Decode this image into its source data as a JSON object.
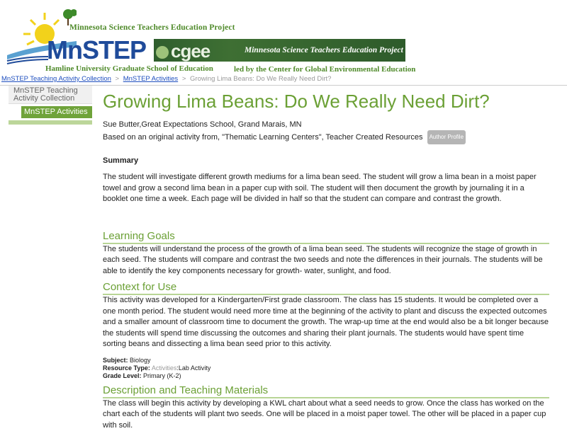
{
  "header": {
    "project_top": "Minnesota Science Teachers Education Project",
    "brand": "MnSTEP",
    "hamline": "Hamline University Graduate School of Education",
    "cgee_logo": "cgee",
    "cgee_project": "Minnesota Science Teachers Education Project",
    "cgee_led": "led by the Center for Global Environmental Education"
  },
  "breadcrumb": {
    "items": [
      "MnSTEP Teaching Activity Collection",
      "MnSTEP Activities",
      "Growing Lima Beans: Do We Really Need Dirt?"
    ],
    "separator": ">"
  },
  "sidebar": {
    "title": "MnSTEP Teaching Activity Collection",
    "active": "MnSTEP Activities"
  },
  "page": {
    "title": "Growing Lima Beans: Do We Really Need Dirt?",
    "author_line": "Sue Butter,Great Expectations School, Grand Marais, MN",
    "source_line": "Based on an original activity from, \"Thematic Learning Centers\", Teacher Created Resources",
    "author_profile": "Author Profile",
    "summary_heading": "Summary",
    "summary_text": "The student will investigate different growth mediums for a lima bean seed. The student will grow a lima bean in a moist paper towel and grow a second lima bean in a paper cup with soil. The student will then document the growth by journaling it in a booklet one time a week. Each page will be divided in half so that the student can compare and contrast the growth.",
    "learning_goals_heading": "Learning Goals",
    "learning_goals_text": "The students will understand the process of the growth of a lima bean seed. The students will recognize the stage of growth in each seed. The students will compare and contrast the two seeds and note the differences in their journals. The students will be able to identify the key components necessary for growth- water, sunlight, and food.",
    "context_heading": "Context for Use",
    "context_text": "This activity was developed for a Kindergarten/First grade classroom. The class has 15 students. It would be completed over a one month period. The student would need more time at the beginning of the activity to plant and discuss the expected outcomes and a smaller amount of classroom time to document the growth. The wrap-up time at the end would also be a bit longer because the students will spend time discussing the outcomes and sharing their plant journals. The students would have spent time sorting beans and dissecting a lima bean seed prior to this activity.",
    "meta": {
      "subject_label": "Subject:",
      "subject_value": "Biology",
      "resource_label": "Resource Type:",
      "resource_prefix": "Activities",
      "resource_value": "Lab Activity",
      "grade_label": "Grade Level:",
      "grade_value": "Primary (K-2)"
    },
    "description_heading": "Description and Teaching Materials",
    "description_text": "The class will begin this activity by developing a KWL chart about what a seed needs to grow. Once the class has worked on the chart each of the students will plant two seeds. One will be placed in a moist paper towel. The other will be placed in a paper cup with soil."
  }
}
